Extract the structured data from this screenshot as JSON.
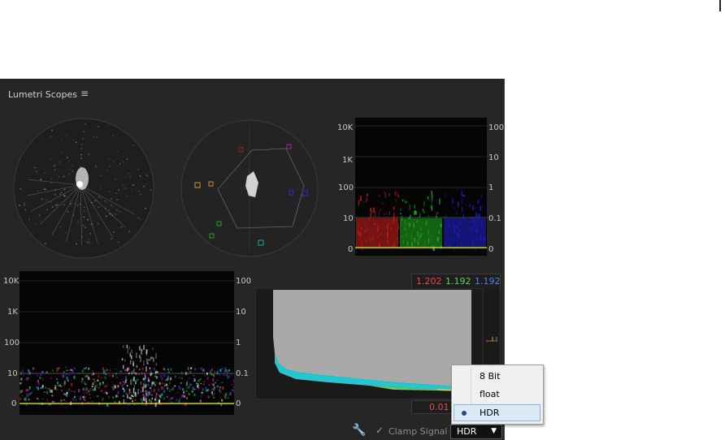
{
  "panel": {
    "title": "Lumetri Scopes",
    "menu_icon": "hamburger-menu-icon"
  },
  "parade": {
    "left_ticks": [
      "10K",
      "1K",
      "100",
      "10",
      "0"
    ],
    "right_ticks": [
      "100",
      "10",
      "1",
      "0.1",
      "0"
    ],
    "colors": {
      "red": "#d42020",
      "green": "#20b020",
      "blue": "#2020d0"
    }
  },
  "waveform": {
    "left_ticks": [
      "10K",
      "1K",
      "100",
      "10",
      "0"
    ],
    "right_ticks": [
      "100",
      "10",
      "1",
      "0.1",
      "0"
    ]
  },
  "histogram": {
    "max_values": {
      "r": "1.202",
      "g": "1.192",
      "b": "1.192"
    },
    "min_value": "0.01",
    "colors": {
      "r": "#e84a4a",
      "g": "#5fd05f",
      "b": "#5b7ee0"
    }
  },
  "footer": {
    "settings_icon": "wrench-icon",
    "clamp_label": "Clamp Signal",
    "clamp_checked": true,
    "mode_value": "HDR"
  },
  "dropdown": {
    "options": [
      "8 Bit",
      "float",
      "HDR"
    ],
    "selected": "HDR"
  }
}
